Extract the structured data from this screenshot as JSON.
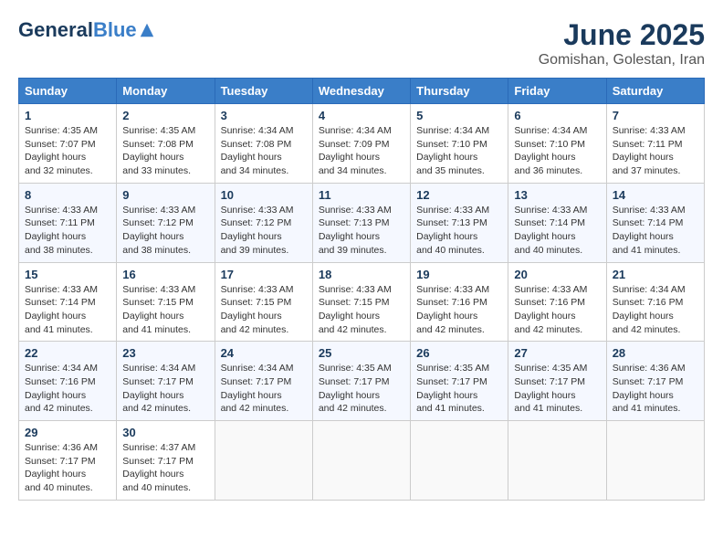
{
  "header": {
    "logo_general": "General",
    "logo_blue": "Blue",
    "month_title": "June 2025",
    "subtitle": "Gomishan, Golestan, Iran"
  },
  "calendar": {
    "days_of_week": [
      "Sunday",
      "Monday",
      "Tuesday",
      "Wednesday",
      "Thursday",
      "Friday",
      "Saturday"
    ],
    "weeks": [
      [
        null,
        {
          "day": 2,
          "sunrise": "4:35 AM",
          "sunset": "7:08 PM",
          "daylight": "14 hours and 33 minutes."
        },
        {
          "day": 3,
          "sunrise": "4:34 AM",
          "sunset": "7:08 PM",
          "daylight": "14 hours and 34 minutes."
        },
        {
          "day": 4,
          "sunrise": "4:34 AM",
          "sunset": "7:09 PM",
          "daylight": "14 hours and 34 minutes."
        },
        {
          "day": 5,
          "sunrise": "4:34 AM",
          "sunset": "7:10 PM",
          "daylight": "14 hours and 35 minutes."
        },
        {
          "day": 6,
          "sunrise": "4:34 AM",
          "sunset": "7:10 PM",
          "daylight": "14 hours and 36 minutes."
        },
        {
          "day": 7,
          "sunrise": "4:33 AM",
          "sunset": "7:11 PM",
          "daylight": "14 hours and 37 minutes."
        }
      ],
      [
        {
          "day": 1,
          "sunrise": "4:35 AM",
          "sunset": "7:07 PM",
          "daylight": "14 hours and 32 minutes."
        },
        {
          "day": 8,
          "sunrise": "4:33 AM",
          "sunset": "7:11 PM",
          "daylight": "14 hours and 38 minutes."
        },
        {
          "day": 9,
          "sunrise": "4:33 AM",
          "sunset": "7:12 PM",
          "daylight": "14 hours and 38 minutes."
        },
        {
          "day": 10,
          "sunrise": "4:33 AM",
          "sunset": "7:12 PM",
          "daylight": "14 hours and 39 minutes."
        },
        {
          "day": 11,
          "sunrise": "4:33 AM",
          "sunset": "7:13 PM",
          "daylight": "14 hours and 39 minutes."
        },
        {
          "day": 12,
          "sunrise": "4:33 AM",
          "sunset": "7:13 PM",
          "daylight": "14 hours and 40 minutes."
        },
        {
          "day": 13,
          "sunrise": "4:33 AM",
          "sunset": "7:14 PM",
          "daylight": "14 hours and 40 minutes."
        }
      ],
      [
        {
          "day": 14,
          "sunrise": "4:33 AM",
          "sunset": "7:14 PM",
          "daylight": "14 hours and 41 minutes."
        },
        {
          "day": 15,
          "sunrise": "4:33 AM",
          "sunset": "7:14 PM",
          "daylight": "14 hours and 41 minutes."
        },
        {
          "day": 16,
          "sunrise": "4:33 AM",
          "sunset": "7:15 PM",
          "daylight": "14 hours and 41 minutes."
        },
        {
          "day": 17,
          "sunrise": "4:33 AM",
          "sunset": "7:15 PM",
          "daylight": "14 hours and 42 minutes."
        },
        {
          "day": 18,
          "sunrise": "4:33 AM",
          "sunset": "7:15 PM",
          "daylight": "14 hours and 42 minutes."
        },
        {
          "day": 19,
          "sunrise": "4:33 AM",
          "sunset": "7:16 PM",
          "daylight": "14 hours and 42 minutes."
        },
        {
          "day": 20,
          "sunrise": "4:33 AM",
          "sunset": "7:16 PM",
          "daylight": "14 hours and 42 minutes."
        }
      ],
      [
        {
          "day": 21,
          "sunrise": "4:34 AM",
          "sunset": "7:16 PM",
          "daylight": "14 hours and 42 minutes."
        },
        {
          "day": 22,
          "sunrise": "4:34 AM",
          "sunset": "7:16 PM",
          "daylight": "14 hours and 42 minutes."
        },
        {
          "day": 23,
          "sunrise": "4:34 AM",
          "sunset": "7:17 PM",
          "daylight": "14 hours and 42 minutes."
        },
        {
          "day": 24,
          "sunrise": "4:34 AM",
          "sunset": "7:17 PM",
          "daylight": "14 hours and 42 minutes."
        },
        {
          "day": 25,
          "sunrise": "4:35 AM",
          "sunset": "7:17 PM",
          "daylight": "14 hours and 42 minutes."
        },
        {
          "day": 26,
          "sunrise": "4:35 AM",
          "sunset": "7:17 PM",
          "daylight": "14 hours and 41 minutes."
        },
        {
          "day": 27,
          "sunrise": "4:35 AM",
          "sunset": "7:17 PM",
          "daylight": "14 hours and 41 minutes."
        }
      ],
      [
        {
          "day": 28,
          "sunrise": "4:36 AM",
          "sunset": "7:17 PM",
          "daylight": "14 hours and 41 minutes."
        },
        {
          "day": 29,
          "sunrise": "4:36 AM",
          "sunset": "7:17 PM",
          "daylight": "14 hours and 40 minutes."
        },
        {
          "day": 30,
          "sunrise": "4:37 AM",
          "sunset": "7:17 PM",
          "daylight": "14 hours and 40 minutes."
        },
        null,
        null,
        null,
        null
      ]
    ]
  }
}
